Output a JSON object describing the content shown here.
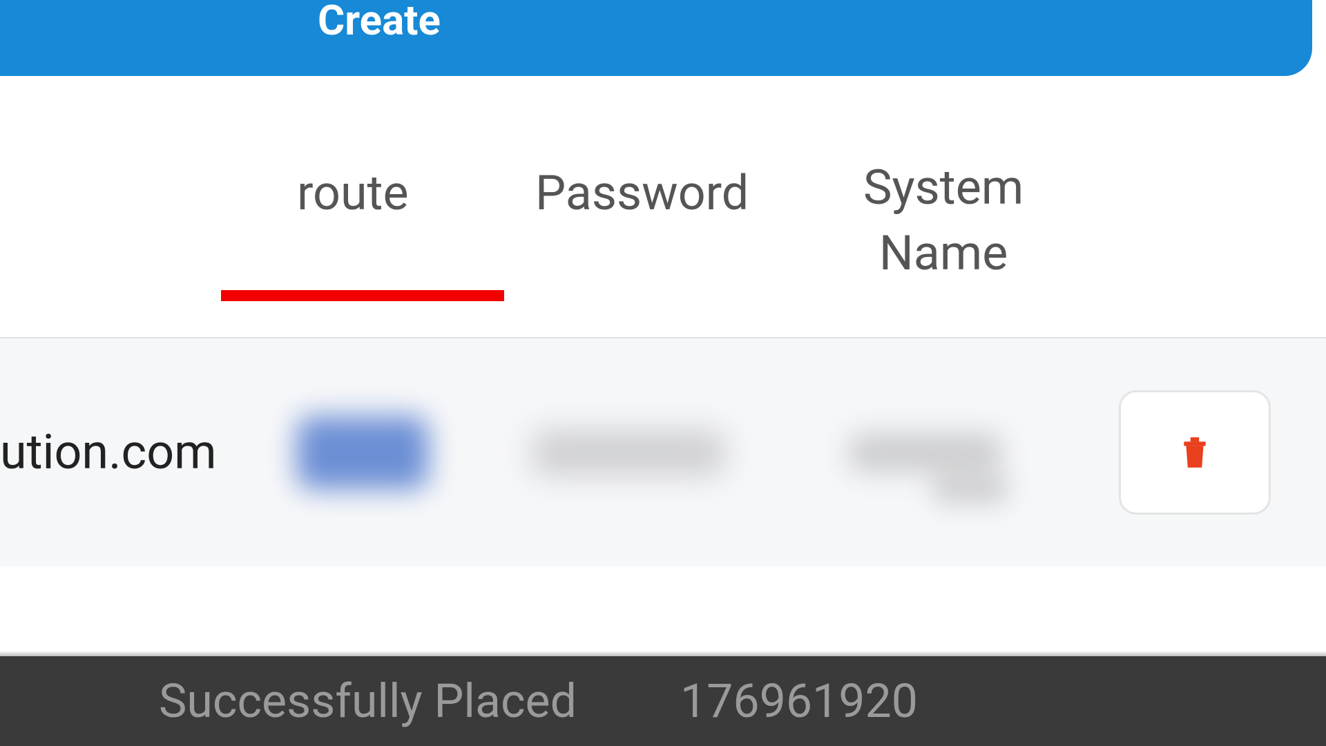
{
  "topbar": {
    "create_label": "Create"
  },
  "headers": {
    "route": "route",
    "password": "Password",
    "system_name_line1": "System",
    "system_name_line2": "Name"
  },
  "row": {
    "domain": "ution.com"
  },
  "status": {
    "message": "Successfully Placed",
    "id": "176961920"
  },
  "icons": {
    "trash": "trash-icon"
  },
  "colors": {
    "primary": "#1789d6",
    "underline": "#f20000",
    "trash": "#e93f1d"
  }
}
